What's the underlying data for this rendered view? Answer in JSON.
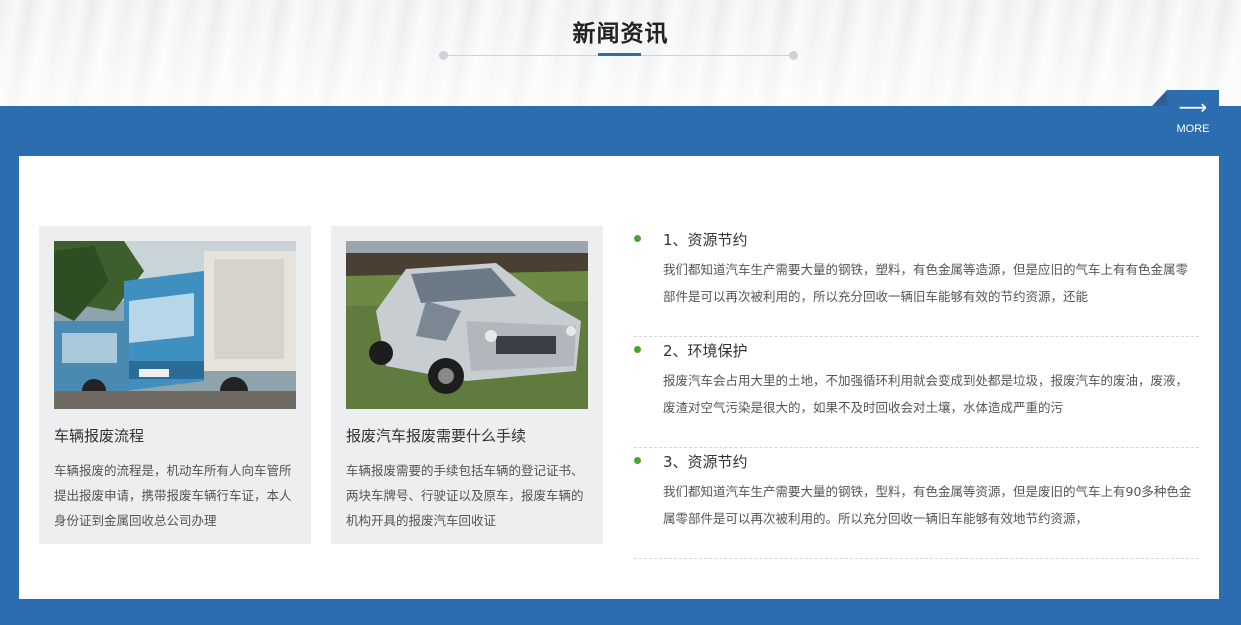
{
  "section": {
    "title": "新闻资讯",
    "more_label": "MORE",
    "more_arrow": "⟶"
  },
  "cards": [
    {
      "title": "车辆报废流程",
      "text": "车辆报废的流程是，机动车所有人向车管所提出报废申请，携带报废车辆行车证，本人身份证到金属回收总公司办理"
    },
    {
      "title": "报废汽车报废需要什么手续",
      "text": "车辆报废需要的手续包括车辆的登记证书、两块车牌号、行驶证以及原车，报废车辆的机构开具的报废汽车回收证"
    }
  ],
  "news": [
    {
      "title": "1、资源节约",
      "text": "我们都知道汽车生产需要大量的钢铁，塑料，有色金属等造源，但是应旧的气车上有有色金属零部件是可以再次被利用的，所以充分回收一辆旧车能够有效的节约资源，还能"
    },
    {
      "title": "2、环境保护",
      "text": "报废汽车会占用大里的土地，不加强循环利用就会变成到处都是垃圾，报废汽车的废油，废液，废渣对空气污染是很大的，如果不及时回收会对土壤，水体造成严重的污"
    },
    {
      "title": "3、资源节约",
      "text": "我们都知道汽车生产需要大量的钢铁，型料，有色金属等资源，但是废旧的气车上有90多种色金属零部件是可以再次被利用的。所以充分回收一辆旧车能够有效地节约资源，"
    }
  ],
  "colors": {
    "brand_blue": "#2c6db0",
    "bullet_green": "#4aa32f"
  }
}
